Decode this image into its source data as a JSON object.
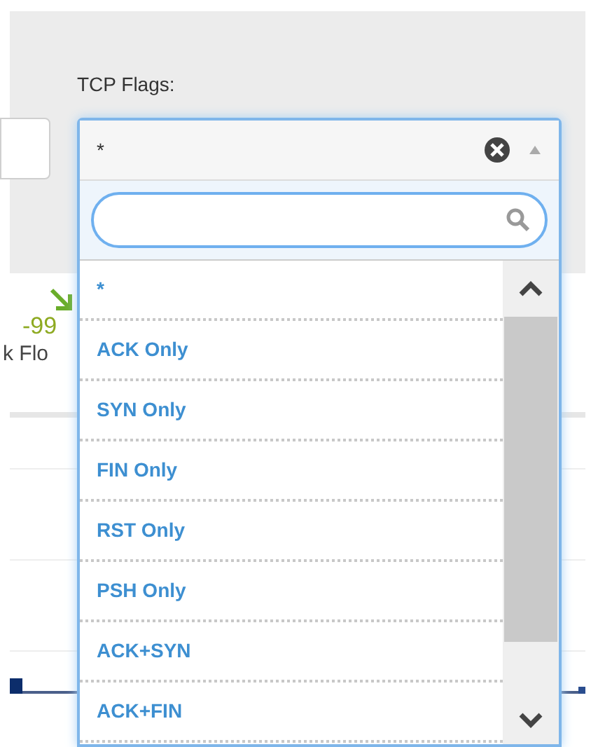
{
  "filter": {
    "label": "TCP Flags:",
    "value": "*",
    "options": [
      {
        "label": "*"
      },
      {
        "label": "ACK Only"
      },
      {
        "label": "SYN Only"
      },
      {
        "label": "FIN Only"
      },
      {
        "label": "RST Only"
      },
      {
        "label": "PSH Only"
      },
      {
        "label": "ACK+SYN"
      },
      {
        "label": "ACK+FIN"
      }
    ]
  },
  "stat": {
    "value": "-99",
    "label": "k Flo"
  }
}
